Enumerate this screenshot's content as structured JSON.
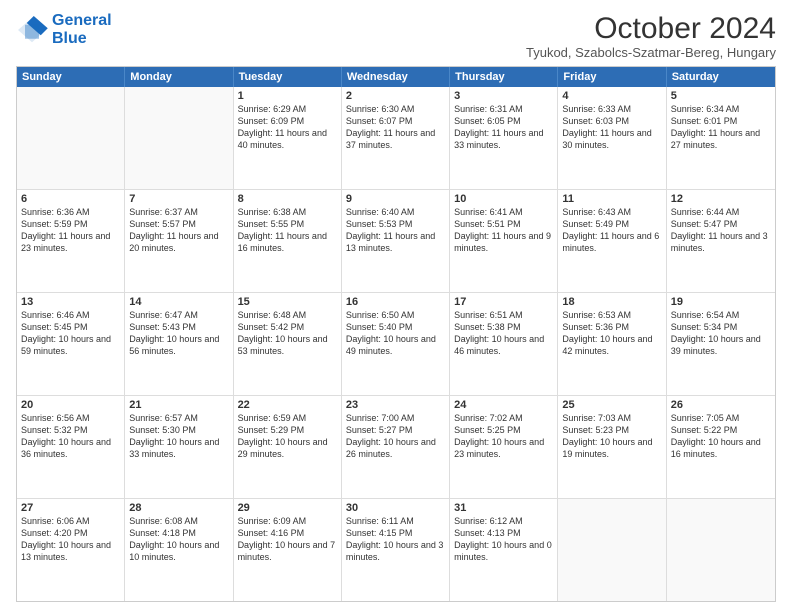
{
  "header": {
    "logo_line1": "General",
    "logo_line2": "Blue",
    "title": "October 2024",
    "subtitle": "Tyukod, Szabolcs-Szatmar-Bereg, Hungary"
  },
  "days_of_week": [
    "Sunday",
    "Monday",
    "Tuesday",
    "Wednesday",
    "Thursday",
    "Friday",
    "Saturday"
  ],
  "weeks": [
    [
      {
        "day": "",
        "sunrise": "",
        "sunset": "",
        "daylight": ""
      },
      {
        "day": "",
        "sunrise": "",
        "sunset": "",
        "daylight": ""
      },
      {
        "day": "1",
        "sunrise": "Sunrise: 6:29 AM",
        "sunset": "Sunset: 6:09 PM",
        "daylight": "Daylight: 11 hours and 40 minutes."
      },
      {
        "day": "2",
        "sunrise": "Sunrise: 6:30 AM",
        "sunset": "Sunset: 6:07 PM",
        "daylight": "Daylight: 11 hours and 37 minutes."
      },
      {
        "day": "3",
        "sunrise": "Sunrise: 6:31 AM",
        "sunset": "Sunset: 6:05 PM",
        "daylight": "Daylight: 11 hours and 33 minutes."
      },
      {
        "day": "4",
        "sunrise": "Sunrise: 6:33 AM",
        "sunset": "Sunset: 6:03 PM",
        "daylight": "Daylight: 11 hours and 30 minutes."
      },
      {
        "day": "5",
        "sunrise": "Sunrise: 6:34 AM",
        "sunset": "Sunset: 6:01 PM",
        "daylight": "Daylight: 11 hours and 27 minutes."
      }
    ],
    [
      {
        "day": "6",
        "sunrise": "Sunrise: 6:36 AM",
        "sunset": "Sunset: 5:59 PM",
        "daylight": "Daylight: 11 hours and 23 minutes."
      },
      {
        "day": "7",
        "sunrise": "Sunrise: 6:37 AM",
        "sunset": "Sunset: 5:57 PM",
        "daylight": "Daylight: 11 hours and 20 minutes."
      },
      {
        "day": "8",
        "sunrise": "Sunrise: 6:38 AM",
        "sunset": "Sunset: 5:55 PM",
        "daylight": "Daylight: 11 hours and 16 minutes."
      },
      {
        "day": "9",
        "sunrise": "Sunrise: 6:40 AM",
        "sunset": "Sunset: 5:53 PM",
        "daylight": "Daylight: 11 hours and 13 minutes."
      },
      {
        "day": "10",
        "sunrise": "Sunrise: 6:41 AM",
        "sunset": "Sunset: 5:51 PM",
        "daylight": "Daylight: 11 hours and 9 minutes."
      },
      {
        "day": "11",
        "sunrise": "Sunrise: 6:43 AM",
        "sunset": "Sunset: 5:49 PM",
        "daylight": "Daylight: 11 hours and 6 minutes."
      },
      {
        "day": "12",
        "sunrise": "Sunrise: 6:44 AM",
        "sunset": "Sunset: 5:47 PM",
        "daylight": "Daylight: 11 hours and 3 minutes."
      }
    ],
    [
      {
        "day": "13",
        "sunrise": "Sunrise: 6:46 AM",
        "sunset": "Sunset: 5:45 PM",
        "daylight": "Daylight: 10 hours and 59 minutes."
      },
      {
        "day": "14",
        "sunrise": "Sunrise: 6:47 AM",
        "sunset": "Sunset: 5:43 PM",
        "daylight": "Daylight: 10 hours and 56 minutes."
      },
      {
        "day": "15",
        "sunrise": "Sunrise: 6:48 AM",
        "sunset": "Sunset: 5:42 PM",
        "daylight": "Daylight: 10 hours and 53 minutes."
      },
      {
        "day": "16",
        "sunrise": "Sunrise: 6:50 AM",
        "sunset": "Sunset: 5:40 PM",
        "daylight": "Daylight: 10 hours and 49 minutes."
      },
      {
        "day": "17",
        "sunrise": "Sunrise: 6:51 AM",
        "sunset": "Sunset: 5:38 PM",
        "daylight": "Daylight: 10 hours and 46 minutes."
      },
      {
        "day": "18",
        "sunrise": "Sunrise: 6:53 AM",
        "sunset": "Sunset: 5:36 PM",
        "daylight": "Daylight: 10 hours and 42 minutes."
      },
      {
        "day": "19",
        "sunrise": "Sunrise: 6:54 AM",
        "sunset": "Sunset: 5:34 PM",
        "daylight": "Daylight: 10 hours and 39 minutes."
      }
    ],
    [
      {
        "day": "20",
        "sunrise": "Sunrise: 6:56 AM",
        "sunset": "Sunset: 5:32 PM",
        "daylight": "Daylight: 10 hours and 36 minutes."
      },
      {
        "day": "21",
        "sunrise": "Sunrise: 6:57 AM",
        "sunset": "Sunset: 5:30 PM",
        "daylight": "Daylight: 10 hours and 33 minutes."
      },
      {
        "day": "22",
        "sunrise": "Sunrise: 6:59 AM",
        "sunset": "Sunset: 5:29 PM",
        "daylight": "Daylight: 10 hours and 29 minutes."
      },
      {
        "day": "23",
        "sunrise": "Sunrise: 7:00 AM",
        "sunset": "Sunset: 5:27 PM",
        "daylight": "Daylight: 10 hours and 26 minutes."
      },
      {
        "day": "24",
        "sunrise": "Sunrise: 7:02 AM",
        "sunset": "Sunset: 5:25 PM",
        "daylight": "Daylight: 10 hours and 23 minutes."
      },
      {
        "day": "25",
        "sunrise": "Sunrise: 7:03 AM",
        "sunset": "Sunset: 5:23 PM",
        "daylight": "Daylight: 10 hours and 19 minutes."
      },
      {
        "day": "26",
        "sunrise": "Sunrise: 7:05 AM",
        "sunset": "Sunset: 5:22 PM",
        "daylight": "Daylight: 10 hours and 16 minutes."
      }
    ],
    [
      {
        "day": "27",
        "sunrise": "Sunrise: 6:06 AM",
        "sunset": "Sunset: 4:20 PM",
        "daylight": "Daylight: 10 hours and 13 minutes."
      },
      {
        "day": "28",
        "sunrise": "Sunrise: 6:08 AM",
        "sunset": "Sunset: 4:18 PM",
        "daylight": "Daylight: 10 hours and 10 minutes."
      },
      {
        "day": "29",
        "sunrise": "Sunrise: 6:09 AM",
        "sunset": "Sunset: 4:16 PM",
        "daylight": "Daylight: 10 hours and 7 minutes."
      },
      {
        "day": "30",
        "sunrise": "Sunrise: 6:11 AM",
        "sunset": "Sunset: 4:15 PM",
        "daylight": "Daylight: 10 hours and 3 minutes."
      },
      {
        "day": "31",
        "sunrise": "Sunrise: 6:12 AM",
        "sunset": "Sunset: 4:13 PM",
        "daylight": "Daylight: 10 hours and 0 minutes."
      },
      {
        "day": "",
        "sunrise": "",
        "sunset": "",
        "daylight": ""
      },
      {
        "day": "",
        "sunrise": "",
        "sunset": "",
        "daylight": ""
      }
    ]
  ]
}
